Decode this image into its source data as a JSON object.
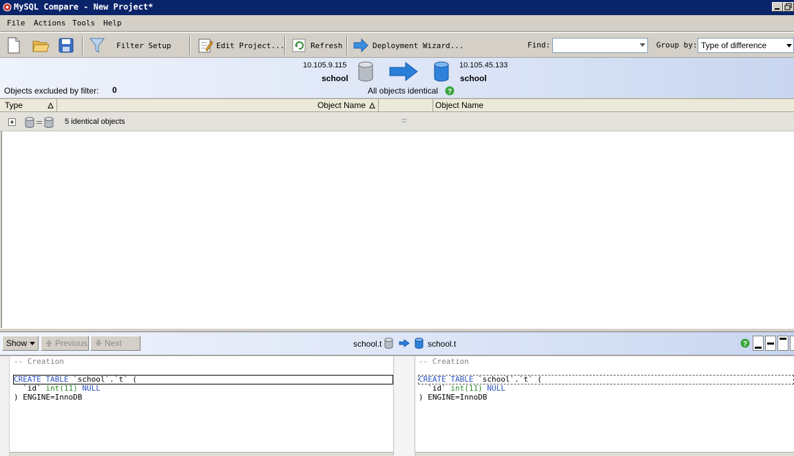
{
  "window": {
    "title": "MySQL Compare - New Project*"
  },
  "menu": {
    "items": [
      "File",
      "Actions",
      "Tools",
      "Help"
    ]
  },
  "toolbar": {
    "filter_label": "Filter Setup",
    "edit_label": "Edit Project...",
    "refresh_label": "Refresh",
    "deploy_label": "Deployment Wizard...",
    "find_label": "Find:",
    "find_value": "",
    "groupby_label": "Group by:",
    "groupby_value": "Type of difference"
  },
  "header": {
    "source_host": "10.105.9.115",
    "source_db": "school",
    "target_host": "10.105.45.133",
    "target_db": "school",
    "excluded_label": "Objects excluded by filter:",
    "excluded_count": "0",
    "status_text": "All objects identical"
  },
  "grid": {
    "col_type": "Type",
    "col_name_left": "Object Name",
    "col_name_right": "Object Name",
    "group_label": "5 identical objects",
    "group_eq": "="
  },
  "bottom": {
    "show_label": "Show",
    "prev_label": "Previous",
    "next_label": "Next",
    "left_object": "school.t",
    "right_object": "school.t"
  },
  "code": {
    "comment": "-- Creation",
    "create": "CREATE TABLE",
    "name": " `school`.`t` (",
    "col": "  `id` ",
    "type": "int(11)",
    "null": " NULL",
    "close": ") ENGINE=InnoDB"
  },
  "colors": {
    "titlebar": "#0a246a",
    "chrome": "#d4d0c8",
    "header_gradient": "#dbe4f6",
    "keyword": "#2a52be",
    "number": "#2a8a2a"
  }
}
